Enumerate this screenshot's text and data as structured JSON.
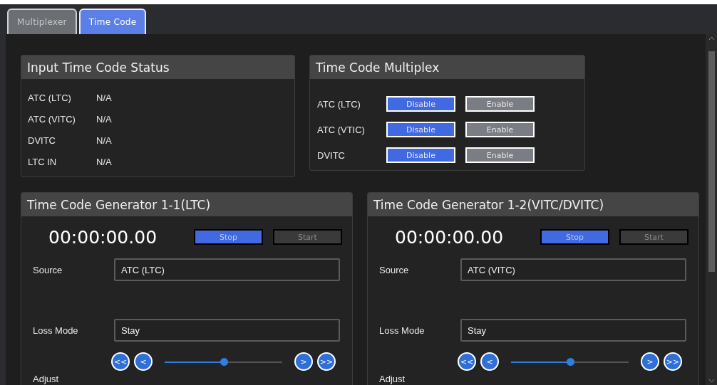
{
  "tabs": [
    {
      "label": "Multiplexer",
      "selected": false
    },
    {
      "label": "Time Code",
      "selected": true
    }
  ],
  "input_status": {
    "title": "Input Time Code Status",
    "rows": [
      {
        "label": "ATC (LTC)",
        "value": "N/A"
      },
      {
        "label": "ATC (VITC)",
        "value": "N/A"
      },
      {
        "label": "DVITC",
        "value": "N/A"
      },
      {
        "label": "LTC IN",
        "value": "N/A"
      }
    ]
  },
  "multiplex": {
    "title": "Time Code Multiplex",
    "rows": [
      {
        "label": "ATC (LTC)",
        "options": [
          {
            "label": "Disable",
            "selected": true
          },
          {
            "label": "Enable",
            "selected": false
          }
        ]
      },
      {
        "label": "ATC (VTIC)",
        "options": [
          {
            "label": "Disable",
            "selected": true
          },
          {
            "label": "Enable",
            "selected": false
          }
        ]
      },
      {
        "label": "DVITC",
        "options": [
          {
            "label": "Disable",
            "selected": true
          },
          {
            "label": "Enable",
            "selected": false
          }
        ]
      }
    ]
  },
  "generators": [
    {
      "title": "Time Code Generator 1-1(LTC)",
      "time": "00:00:00.00",
      "controls": [
        {
          "label": "Stop",
          "selected": true
        },
        {
          "label": "Start",
          "selected": false
        }
      ],
      "source": {
        "label": "Source",
        "value": "ATC (LTC)"
      },
      "loss_mode": {
        "label": "Loss Mode",
        "value": "Stay"
      },
      "adjust": {
        "label": "Adjust",
        "back_buttons": [
          "<<",
          "<"
        ],
        "forward_buttons": [
          ">",
          ">>"
        ],
        "level": 0.5
      }
    },
    {
      "title": "Time Code Generator 1-2(VITC/DVITC)",
      "time": "00:00:00.00",
      "controls": [
        {
          "label": "Stop",
          "selected": true
        },
        {
          "label": "Start",
          "selected": false
        }
      ],
      "source": {
        "label": "Source",
        "value": "ATC (VITC)"
      },
      "loss_mode": {
        "label": "Loss Mode",
        "value": "Stay"
      },
      "adjust": {
        "label": "Adjust",
        "back_buttons": [
          "<<",
          "<"
        ],
        "forward_buttons": [
          ">",
          ">>"
        ],
        "level": 0.5
      }
    }
  ]
}
